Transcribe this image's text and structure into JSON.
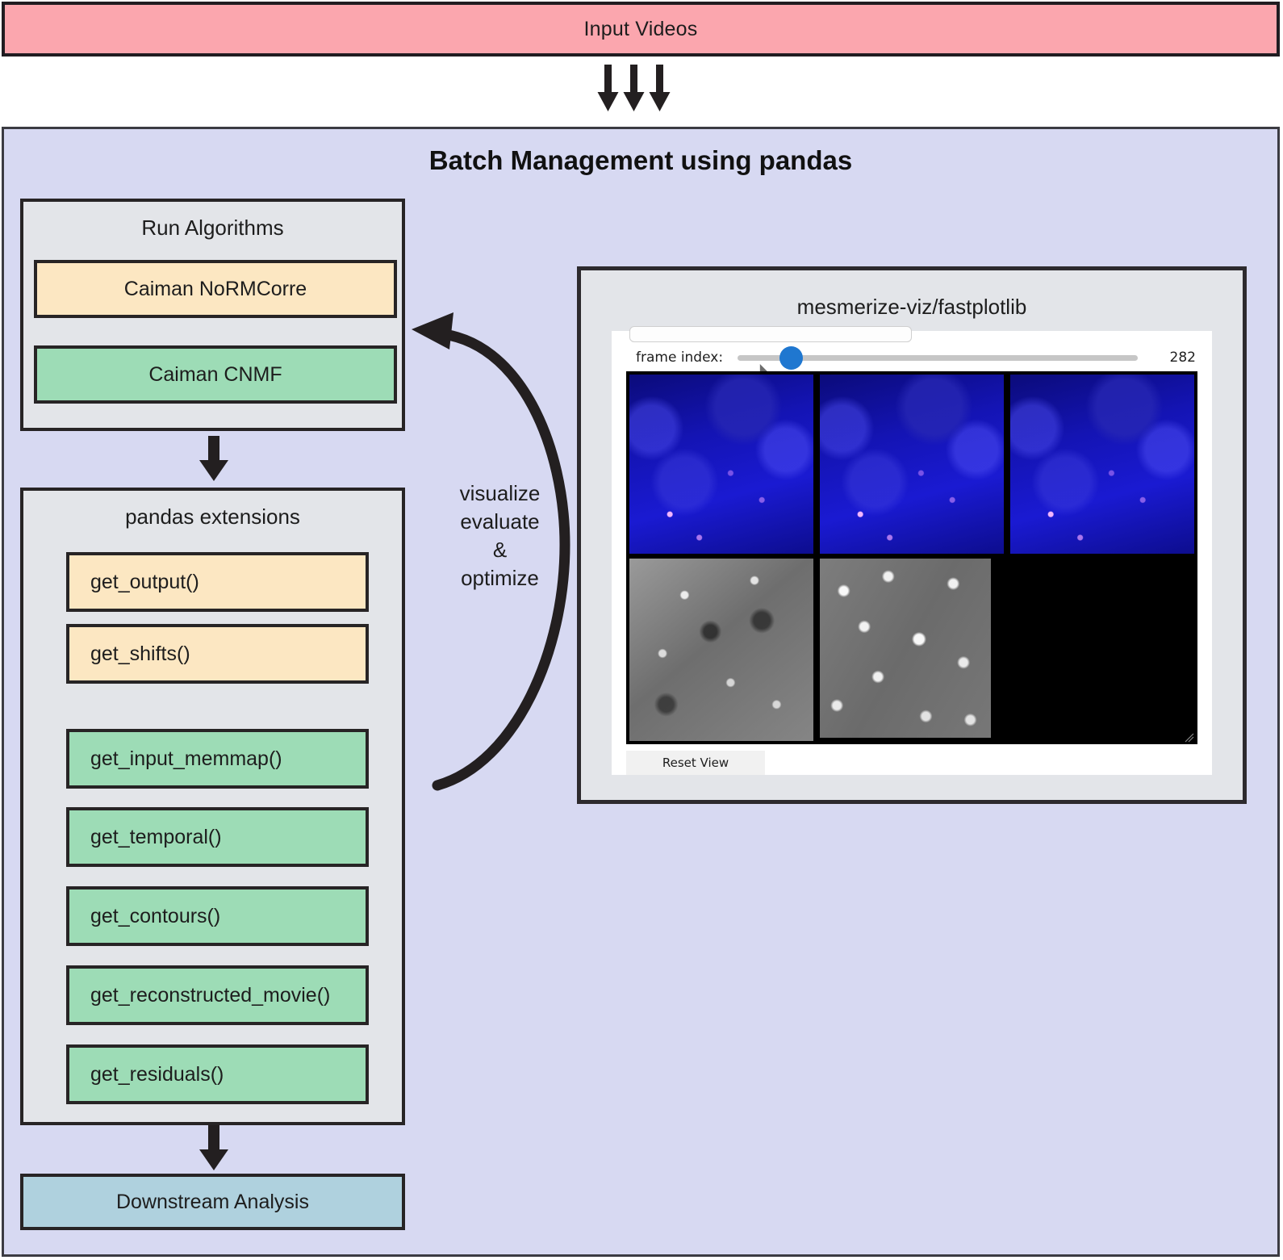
{
  "input": {
    "label": "Input Videos",
    "color": "#FBA6AE"
  },
  "flow_arrows": {
    "top_count": 3,
    "icon": "down-arrow-icon"
  },
  "batch": {
    "title": "Batch Management using pandas",
    "color": "#D7D9F2"
  },
  "run_algorithms": {
    "title": "Run Algorithms",
    "items": [
      {
        "label": "Caiman NoRMCorre",
        "color": "#FCE7C2"
      },
      {
        "label": "Caiman CNMF",
        "color": "#9DDCB6"
      }
    ]
  },
  "pandas_extensions": {
    "title": "pandas extensions",
    "items": [
      {
        "label": "get_output()",
        "color": "#FCE7C2"
      },
      {
        "label": "get_shifts()",
        "color": "#FCE7C2"
      },
      {
        "label": "get_input_memmap()",
        "color": "#9DDCB6"
      },
      {
        "label": "get_temporal()",
        "color": "#9DDCB6"
      },
      {
        "label": "get_contours()",
        "color": "#9DDCB6"
      },
      {
        "label": "get_reconstructed_movie()",
        "color": "#9DDCB6"
      },
      {
        "label": "get_residuals()",
        "color": "#9DDCB6"
      }
    ]
  },
  "downstream": {
    "label": "Downstream Analysis",
    "color": "#AFD1DE"
  },
  "feedback_loop": {
    "lines": [
      "visualize",
      "evaluate",
      "&",
      "optimize"
    ],
    "text": "visualize\nevaluate\n&\noptimize"
  },
  "viz": {
    "title": "mesmerize-viz/fastplotlib",
    "slider": {
      "label": "frame index:",
      "value": "282",
      "position_percent": 8,
      "thumb_color": "#1f77d0"
    },
    "reset_button": "Reset View",
    "grid": {
      "rows": 2,
      "cols": 3,
      "cells": [
        {
          "kind": "blue-calcium-movie"
        },
        {
          "kind": "blue-calcium-movie"
        },
        {
          "kind": "blue-calcium-movie"
        },
        {
          "kind": "grayscale-raw-movie"
        },
        {
          "kind": "grayscale-reconstructed-movie"
        },
        {
          "kind": "black-empty"
        }
      ]
    }
  }
}
